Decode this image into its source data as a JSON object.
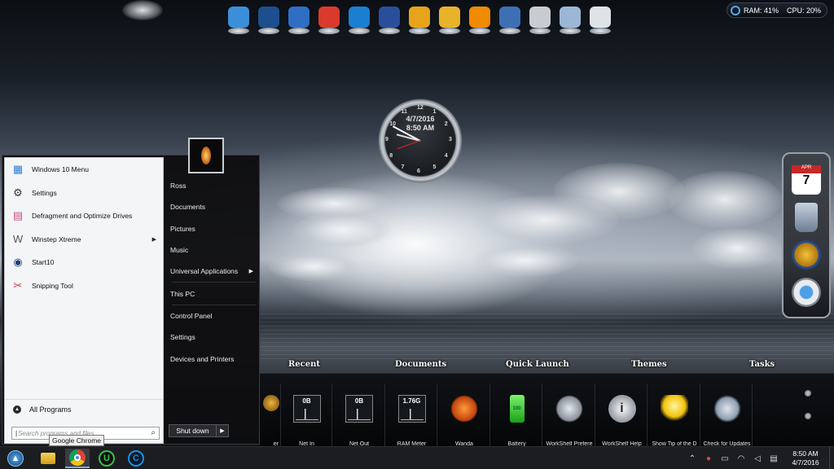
{
  "system_meter": {
    "ram": "RAM: 41%",
    "cpu": "CPU: 20%"
  },
  "clock_widget": {
    "date": "4/7/2016",
    "time": "8:50 AM",
    "numbers": [
      "12",
      "1",
      "2",
      "3",
      "4",
      "5",
      "6",
      "7",
      "8",
      "9",
      "10",
      "11"
    ]
  },
  "top_dock": {
    "icons": [
      {
        "name": "globe-icon",
        "color": "#3b8fd9"
      },
      {
        "name": "start10-icon",
        "color": "#1d4f8e"
      },
      {
        "name": "windows-update-icon",
        "color": "#2e6fc4"
      },
      {
        "name": "ccleaner-icon",
        "color": "#d93a2c"
      },
      {
        "name": "sync-icon",
        "color": "#1a7fd0"
      },
      {
        "name": "malwarebytes-icon",
        "color": "#2a4f9a"
      },
      {
        "name": "winstep-icon",
        "color": "#e7a31a"
      },
      {
        "name": "sun-weather-icon",
        "color": "#e8b22a"
      },
      {
        "name": "vlc-icon",
        "color": "#f08a00"
      },
      {
        "name": "nexus-icon",
        "color": "#3d6fb5"
      },
      {
        "name": "drive-icon",
        "color": "#c7ccd2"
      },
      {
        "name": "recycle-bin-icon",
        "color": "#9cb6d6"
      },
      {
        "name": "weather-icon",
        "color": "#dfe3e8"
      }
    ]
  },
  "start_menu": {
    "left_items": [
      {
        "label": "Windows 10 Menu",
        "icon": "windows-menu-icon",
        "color": "#2f7fd4",
        "glyph": "▦",
        "arrow": ""
      },
      {
        "label": "Settings",
        "icon": "gear-icon",
        "color": "#333333",
        "glyph": "⚙",
        "arrow": ""
      },
      {
        "label": "Defragment and Optimize Drives",
        "icon": "defrag-icon",
        "color": "#c94b8a",
        "glyph": "▤",
        "arrow": ""
      },
      {
        "label": "Winstep Xtreme",
        "icon": "winstep-icon",
        "color": "#555555",
        "glyph": "W",
        "arrow": "▶"
      },
      {
        "label": "Start10",
        "icon": "start10-icon",
        "color": "#1d3f78",
        "glyph": "◉",
        "arrow": ""
      },
      {
        "label": "Snipping Tool",
        "icon": "scissors-icon",
        "color": "#c0394a",
        "glyph": "✂",
        "arrow": ""
      }
    ],
    "all_programs": "All Programs",
    "search_placeholder": "Search programs and files",
    "right_items": [
      {
        "label": "Ross",
        "arrow": ""
      },
      {
        "label": "Documents",
        "arrow": ""
      },
      {
        "label": "Pictures",
        "arrow": ""
      },
      {
        "label": "Music",
        "arrow": ""
      },
      {
        "label": "Universal Applications",
        "arrow": "▶"
      },
      {
        "label": "This PC",
        "arrow": ""
      },
      {
        "label": "Control Panel",
        "arrow": ""
      },
      {
        "label": "Settings",
        "arrow": ""
      },
      {
        "label": "Devices and Printers",
        "arrow": ""
      }
    ],
    "shutdown": "Shut down",
    "shutdown_arrow": "▶"
  },
  "right_dock": {
    "calendar_month": "APR",
    "calendar_day": "7"
  },
  "workshelf": {
    "tabs": [
      "Recent",
      "Documents",
      "Quick Launch",
      "Themes",
      "Tasks"
    ],
    "tiles": [
      {
        "caption": "Net In",
        "meter_value": "0B",
        "kind": "meter"
      },
      {
        "caption": "Net Out",
        "meter_value": "0B",
        "kind": "meter"
      },
      {
        "caption": "RAM Meter",
        "meter_value": "1.76G",
        "kind": "meter"
      },
      {
        "caption": "Wanda",
        "meter_value": "",
        "kind": "fish-icon"
      },
      {
        "caption": "Battery",
        "meter_value": "100",
        "kind": "battery-icon"
      },
      {
        "caption": "WorkShelf Prefere",
        "meter_value": "",
        "kind": "tools-icon"
      },
      {
        "caption": "WorkShelf Help",
        "meter_value": "",
        "kind": "info-icon"
      },
      {
        "caption": "Show Tip of the D",
        "meter_value": "",
        "kind": "lightbulb-icon"
      },
      {
        "caption": "Check for Updates",
        "meter_value": "",
        "kind": "update-icon"
      }
    ],
    "partial_caption": "er"
  },
  "taskbar": {
    "tooltip": "Google Chrome",
    "clock_time": "8:50 AM",
    "clock_date": "4/7/2016",
    "tray_icons": [
      "chevron-up-icon",
      "chrome-tray-icon",
      "network-icon",
      "wifi-icon",
      "volume-icon",
      "notification-icon"
    ]
  }
}
